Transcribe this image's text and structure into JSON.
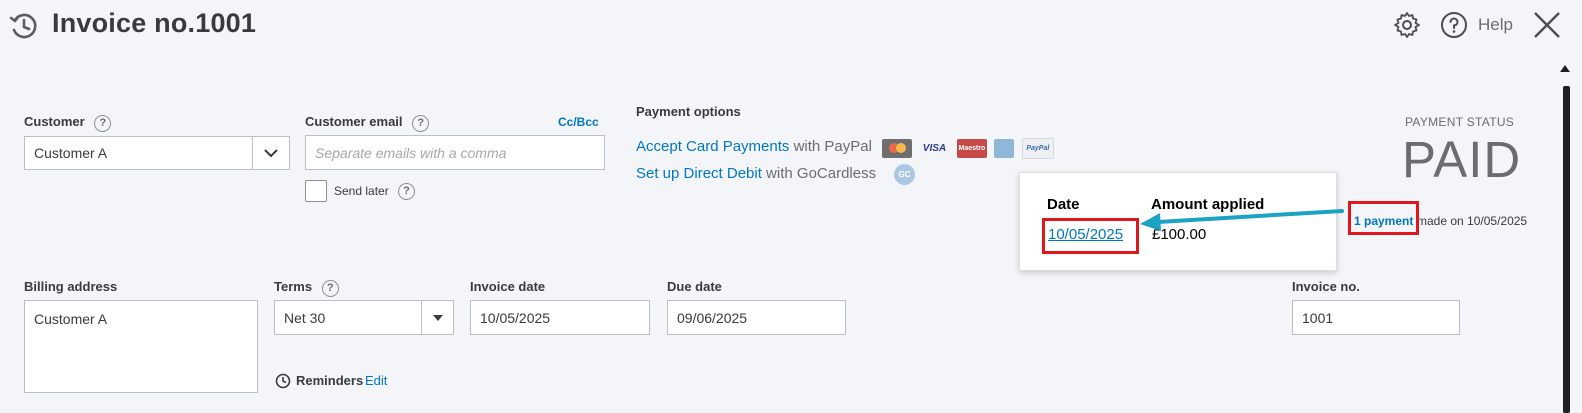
{
  "header": {
    "title": "Invoice no.1001",
    "help_label": "Help"
  },
  "customer": {
    "label": "Customer",
    "value": "Customer A"
  },
  "customer_email": {
    "label": "Customer email",
    "placeholder": "Separate emails with a comma",
    "cc_bcc": "Cc/Bcc",
    "send_later": "Send later"
  },
  "payment_options": {
    "title": "Payment options",
    "card_link": "Accept Card Payments",
    "card_suffix": " with PayPal",
    "debit_link": "Set up Direct Debit",
    "debit_suffix": " with GoCardless",
    "card_logos": [
      "MasterCard",
      "VISA",
      "Maestro",
      "AMEX",
      "PayPal"
    ],
    "gc_badge": "GC"
  },
  "payment_status": {
    "label": "PAYMENT STATUS",
    "value": "PAID",
    "payment_link": "1 payment",
    "made_on": "made on 10/05/2025"
  },
  "popover": {
    "date_header": "Date",
    "amount_header": "Amount applied",
    "date_value": "10/05/2025",
    "amount_value": "£100.00"
  },
  "billing": {
    "label": "Billing address",
    "value": "Customer A"
  },
  "terms": {
    "label": "Terms",
    "value": "Net 30"
  },
  "invoice_date": {
    "label": "Invoice date",
    "value": "10/05/2025"
  },
  "due_date": {
    "label": "Due date",
    "value": "09/06/2025"
  },
  "invoice_no": {
    "label": "Invoice no.",
    "value": "1001"
  },
  "reminders": {
    "label": "Reminders",
    "edit": "Edit"
  },
  "colors": {
    "accent": "#0077c5",
    "annotation_red": "#e0181d",
    "annotation_arrow": "#1aa3c4"
  }
}
